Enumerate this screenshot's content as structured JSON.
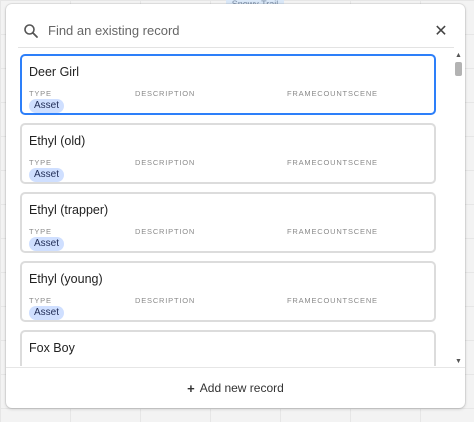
{
  "background": {
    "chip_text": "Snowy Trail"
  },
  "search": {
    "placeholder": "Find an existing record",
    "value": ""
  },
  "close_label": "✕",
  "field_labels": {
    "type": "TYPE",
    "description": "DESCRIPTION",
    "framecount": "FRAMECOUNT",
    "scene": "SCENE"
  },
  "records": [
    {
      "name": "Deer Girl",
      "type": "Asset",
      "selected": true
    },
    {
      "name": "Ethyl (old)",
      "type": "Asset"
    },
    {
      "name": "Ethyl (trapper)",
      "type": "Asset"
    },
    {
      "name": "Ethyl (young)",
      "type": "Asset"
    },
    {
      "name": "Fox Boy",
      "type": ""
    }
  ],
  "footer": {
    "plus": "+",
    "label": "Add new record"
  },
  "colors": {
    "accent": "#2d7ff9",
    "pill_bg": "#cfdfff"
  }
}
